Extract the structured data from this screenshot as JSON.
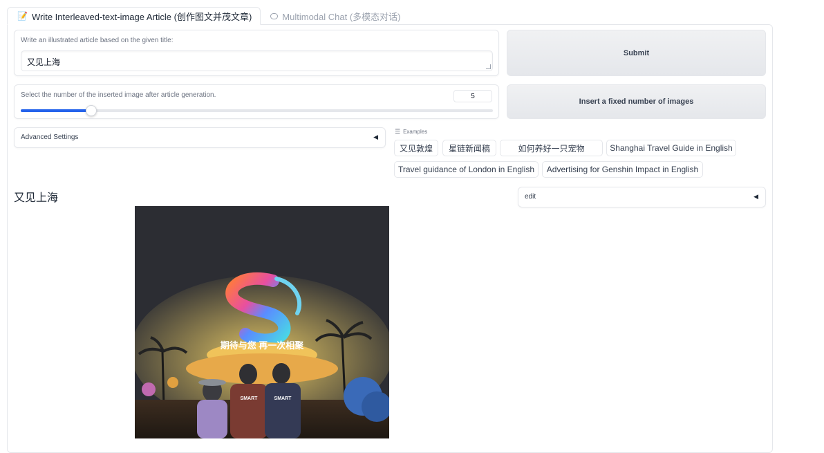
{
  "tabs": [
    {
      "icon": "📝",
      "label": "Write Interleaved-text-image Article (创作图文并茂文章)",
      "active": true
    },
    {
      "icon": "💬",
      "label": "Multimodal Chat (多模态对话)",
      "active": false
    }
  ],
  "title_input": {
    "label": "Write an illustrated article based on the given title:",
    "value": "又见上海"
  },
  "submit": {
    "label": "Submit"
  },
  "image_count": {
    "label": "Select the number of the inserted image after article generation.",
    "value": "5",
    "level": 0.15
  },
  "insert_button": {
    "label": "Insert a fixed number of images"
  },
  "advanced": {
    "label": "Advanced Settings",
    "arrow": "◀"
  },
  "examples": {
    "header": "Examples",
    "items": [
      "又见敦煌",
      "星链新闻稿",
      "如何养好一只宠物",
      "Shanghai Travel Guide in English",
      "Travel guidance of London in English",
      "Advertising for Genshin Impact in English"
    ]
  },
  "output": {
    "title": "又见上海"
  },
  "edit": {
    "label": "edit",
    "arrow": "◀"
  },
  "photo": {
    "sign_text": "期待与您 再一次相聚",
    "shirt_text": "SMART"
  }
}
